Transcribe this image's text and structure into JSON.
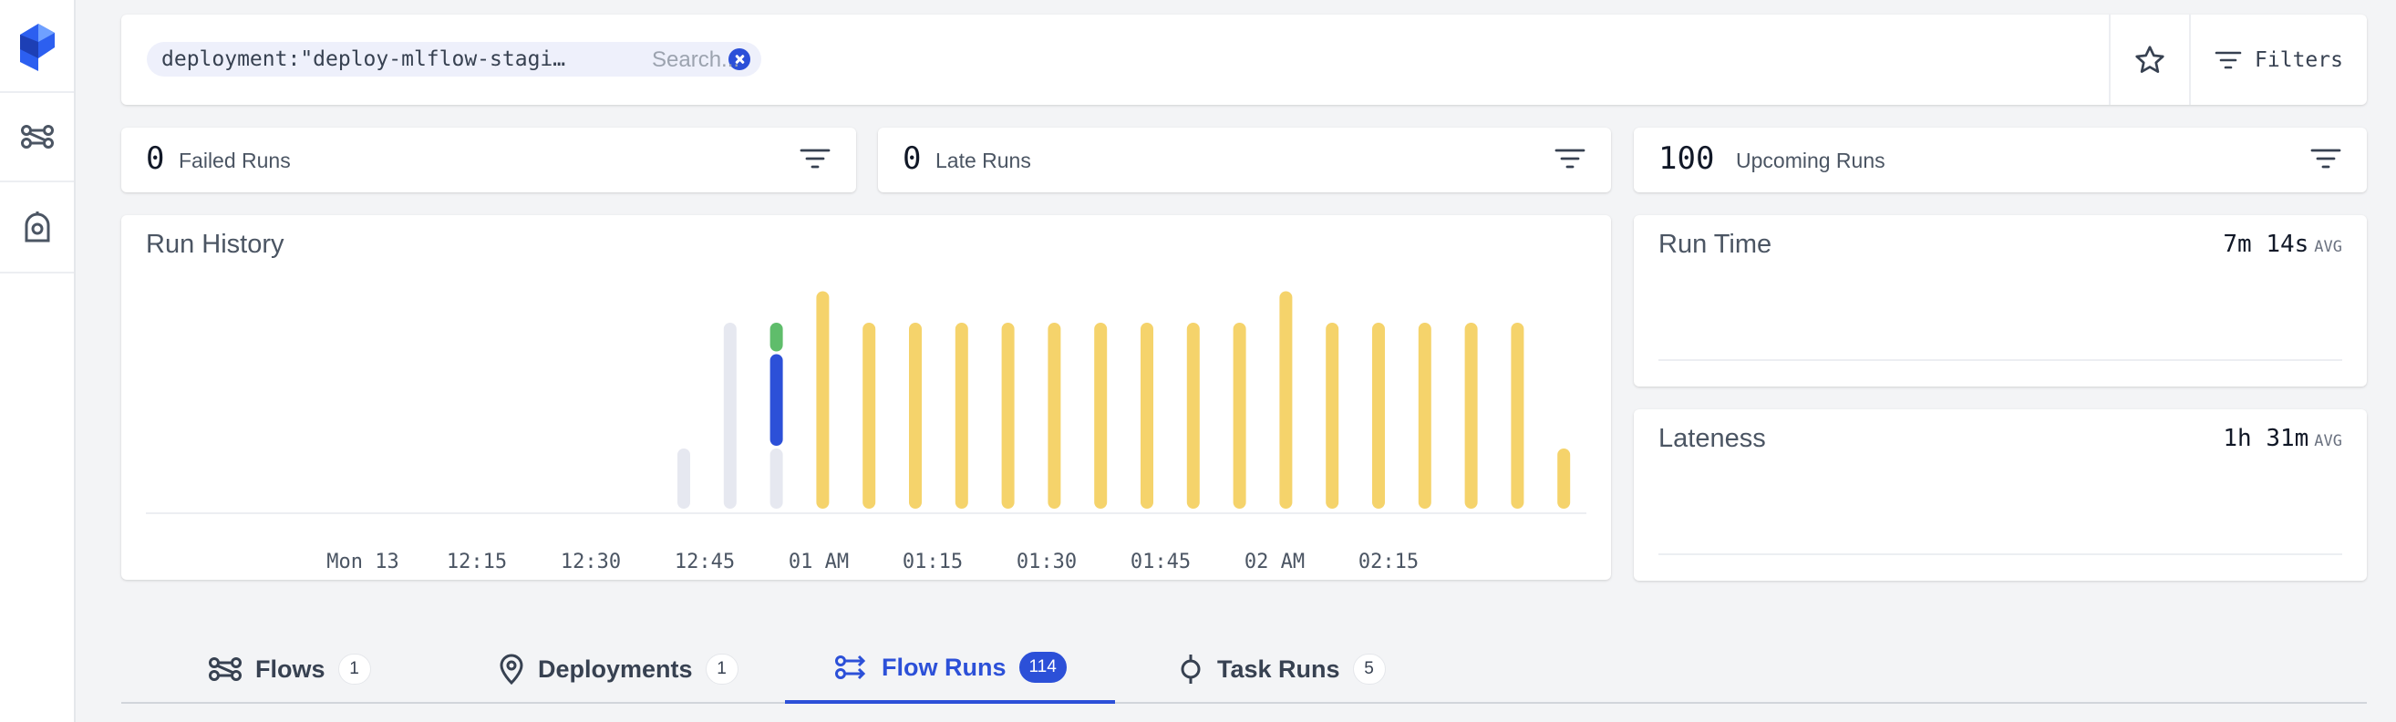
{
  "sidebar": {
    "logo_icon": "prefect-logo-icon",
    "items": [
      {
        "icon": "flows-icon"
      },
      {
        "icon": "work-pool-icon"
      }
    ]
  },
  "search": {
    "chip_text": "deployment:\"deploy-mlflow-stagi…",
    "placeholder": "Search...",
    "filters_label": "Filters"
  },
  "stats": [
    {
      "value": "0",
      "label": "Failed Runs"
    },
    {
      "value": "0",
      "label": "Late Runs"
    },
    {
      "value": "100",
      "label": "Upcoming Runs"
    }
  ],
  "run_history": {
    "title": "Run History"
  },
  "metrics": {
    "run_time": {
      "title": "Run Time",
      "value": "7m 14s",
      "unit": "AVG"
    },
    "lateness": {
      "title": "Lateness",
      "value": "1h 31m",
      "unit": "AVG"
    }
  },
  "tabs": [
    {
      "label": "Flows",
      "count": "1",
      "icon": "flows-icon"
    },
    {
      "label": "Deployments",
      "count": "1",
      "icon": "location-pin-icon"
    },
    {
      "label": "Flow Runs",
      "count": "114",
      "icon": "flow-runs-icon",
      "active": true
    },
    {
      "label": "Task Runs",
      "count": "5",
      "icon": "task-runs-icon"
    }
  ],
  "colors": {
    "completed": "#5fbd6b",
    "running": "#2c50d8",
    "scheduled": "#f5d36b",
    "pending": "#e6e8f0",
    "accent": "#2c50d8"
  },
  "chart_data": {
    "type": "bar",
    "stacked": true,
    "title": "Run History",
    "x_ticks": [
      "Mon 13",
      "12:15",
      "12:30",
      "12:45",
      "01 AM",
      "01:15",
      "01:30",
      "01:45",
      "02 AM",
      "02:15"
    ],
    "bucket_count": 20,
    "series": [
      {
        "state": "pending",
        "color": "#e6e8f0",
        "values": [
          2,
          6,
          2,
          0,
          0,
          0,
          0,
          0,
          0,
          0,
          0,
          0,
          0,
          0,
          0,
          0,
          0,
          0,
          0,
          0
        ]
      },
      {
        "state": "running",
        "color": "#2c50d8",
        "values": [
          0,
          0,
          3,
          0,
          0,
          0,
          0,
          0,
          0,
          0,
          0,
          0,
          0,
          0,
          0,
          0,
          0,
          0,
          0,
          0
        ]
      },
      {
        "state": "completed",
        "color": "#5fbd6b",
        "values": [
          0,
          0,
          1,
          0,
          0,
          0,
          0,
          0,
          0,
          0,
          0,
          0,
          0,
          0,
          0,
          0,
          0,
          0,
          0,
          0
        ]
      },
      {
        "state": "scheduled",
        "color": "#f5d36b",
        "values": [
          0,
          0,
          0,
          7,
          6,
          6,
          6,
          6,
          6,
          6,
          6,
          6,
          6,
          7,
          6,
          6,
          6,
          6,
          6,
          2
        ]
      }
    ],
    "ylim": [
      0,
      7
    ],
    "grid": false,
    "legend": "none"
  }
}
